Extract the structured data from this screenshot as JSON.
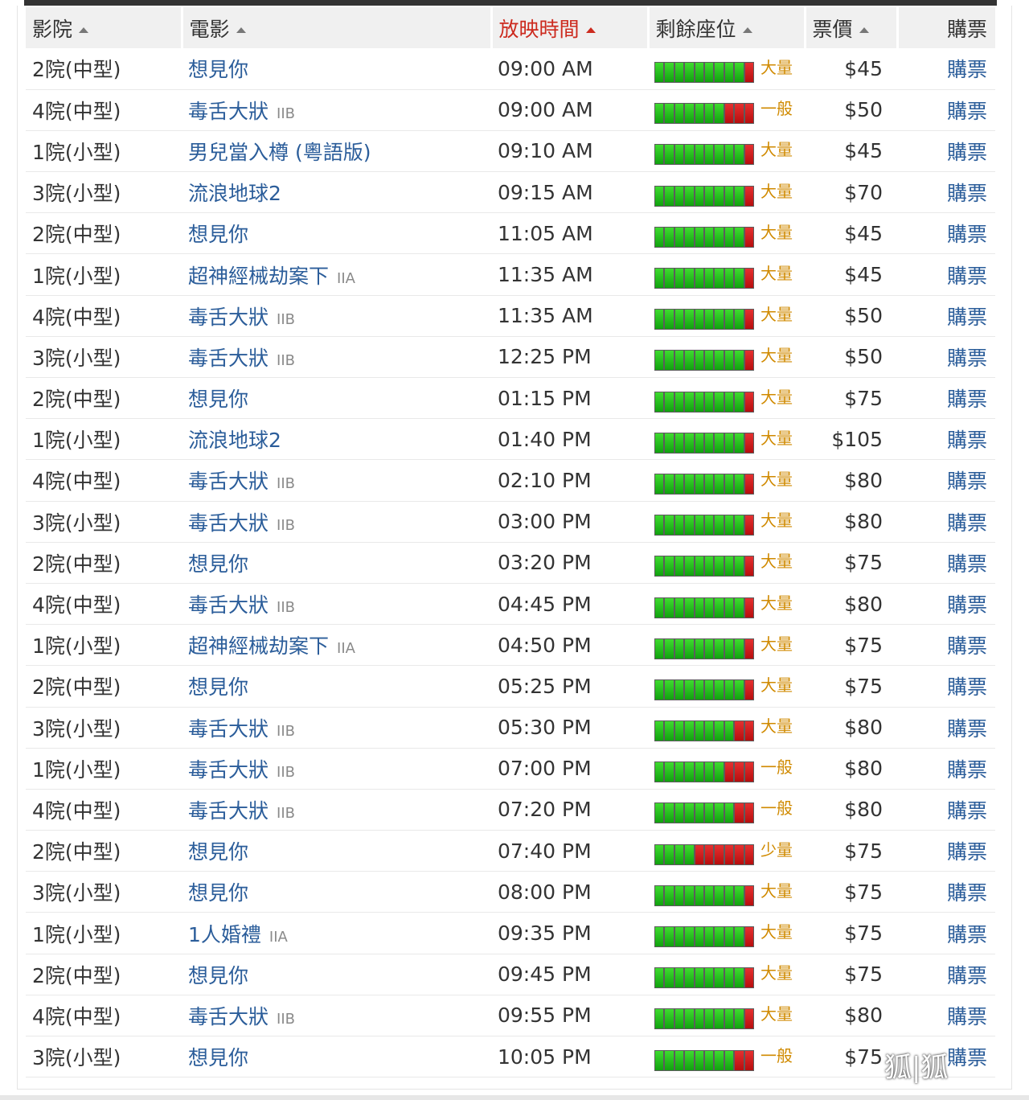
{
  "headers": {
    "cinema": "影院",
    "film": "電影",
    "time": "放映時間",
    "seats": "剩餘座位",
    "price": "票價",
    "buy": "購票"
  },
  "sorted_column": "time",
  "colors": {
    "accent_sort": "#cc2a1e",
    "link": "#2b5d9a",
    "meter_green": "#22c21b",
    "meter_red": "#cc1515",
    "availability_text": "#d08a00"
  },
  "watermark": "狐|狐",
  "rows": [
    {
      "cinema": "2院(中型)",
      "film": "想見你",
      "rating": "",
      "time": "09:00 AM",
      "seats_filled": 9,
      "seats_label": "大量",
      "price": "$45",
      "buy": "購票"
    },
    {
      "cinema": "4院(中型)",
      "film": "毒舌大狀",
      "rating": "IIB",
      "time": "09:00 AM",
      "seats_filled": 7,
      "seats_label": "一般",
      "price": "$50",
      "buy": "購票"
    },
    {
      "cinema": "1院(小型)",
      "film": "男兒當入樽 (粵語版)",
      "rating": "",
      "time": "09:10 AM",
      "seats_filled": 9,
      "seats_label": "大量",
      "price": "$45",
      "buy": "購票"
    },
    {
      "cinema": "3院(小型)",
      "film": "流浪地球2",
      "rating": "",
      "time": "09:15 AM",
      "seats_filled": 9,
      "seats_label": "大量",
      "price": "$70",
      "buy": "購票"
    },
    {
      "cinema": "2院(中型)",
      "film": "想見你",
      "rating": "",
      "time": "11:05 AM",
      "seats_filled": 9,
      "seats_label": "大量",
      "price": "$45",
      "buy": "購票"
    },
    {
      "cinema": "1院(小型)",
      "film": "超神經械劫案下",
      "rating": "IIA",
      "time": "11:35 AM",
      "seats_filled": 9,
      "seats_label": "大量",
      "price": "$45",
      "buy": "購票"
    },
    {
      "cinema": "4院(中型)",
      "film": "毒舌大狀",
      "rating": "IIB",
      "time": "11:35 AM",
      "seats_filled": 9,
      "seats_label": "大量",
      "price": "$50",
      "buy": "購票"
    },
    {
      "cinema": "3院(小型)",
      "film": "毒舌大狀",
      "rating": "IIB",
      "time": "12:25 PM",
      "seats_filled": 9,
      "seats_label": "大量",
      "price": "$50",
      "buy": "購票"
    },
    {
      "cinema": "2院(中型)",
      "film": "想見你",
      "rating": "",
      "time": "01:15 PM",
      "seats_filled": 9,
      "seats_label": "大量",
      "price": "$75",
      "buy": "購票"
    },
    {
      "cinema": "1院(小型)",
      "film": "流浪地球2",
      "rating": "",
      "time": "01:40 PM",
      "seats_filled": 9,
      "seats_label": "大量",
      "price": "$105",
      "buy": "購票"
    },
    {
      "cinema": "4院(中型)",
      "film": "毒舌大狀",
      "rating": "IIB",
      "time": "02:10 PM",
      "seats_filled": 9,
      "seats_label": "大量",
      "price": "$80",
      "buy": "購票"
    },
    {
      "cinema": "3院(小型)",
      "film": "毒舌大狀",
      "rating": "IIB",
      "time": "03:00 PM",
      "seats_filled": 9,
      "seats_label": "大量",
      "price": "$80",
      "buy": "購票"
    },
    {
      "cinema": "2院(中型)",
      "film": "想見你",
      "rating": "",
      "time": "03:20 PM",
      "seats_filled": 9,
      "seats_label": "大量",
      "price": "$75",
      "buy": "購票"
    },
    {
      "cinema": "4院(中型)",
      "film": "毒舌大狀",
      "rating": "IIB",
      "time": "04:45 PM",
      "seats_filled": 9,
      "seats_label": "大量",
      "price": "$80",
      "buy": "購票"
    },
    {
      "cinema": "1院(小型)",
      "film": "超神經械劫案下",
      "rating": "IIA",
      "time": "04:50 PM",
      "seats_filled": 9,
      "seats_label": "大量",
      "price": "$75",
      "buy": "購票"
    },
    {
      "cinema": "2院(中型)",
      "film": "想見你",
      "rating": "",
      "time": "05:25 PM",
      "seats_filled": 9,
      "seats_label": "大量",
      "price": "$75",
      "buy": "購票"
    },
    {
      "cinema": "3院(小型)",
      "film": "毒舌大狀",
      "rating": "IIB",
      "time": "05:30 PM",
      "seats_filled": 8,
      "seats_label": "大量",
      "price": "$80",
      "buy": "購票"
    },
    {
      "cinema": "1院(小型)",
      "film": "毒舌大狀",
      "rating": "IIB",
      "time": "07:00 PM",
      "seats_filled": 7,
      "seats_label": "一般",
      "price": "$80",
      "buy": "購票"
    },
    {
      "cinema": "4院(中型)",
      "film": "毒舌大狀",
      "rating": "IIB",
      "time": "07:20 PM",
      "seats_filled": 8,
      "seats_label": "一般",
      "price": "$80",
      "buy": "購票"
    },
    {
      "cinema": "2院(中型)",
      "film": "想見你",
      "rating": "",
      "time": "07:40 PM",
      "seats_filled": 4,
      "seats_label": "少量",
      "price": "$75",
      "buy": "購票"
    },
    {
      "cinema": "3院(小型)",
      "film": "想見你",
      "rating": "",
      "time": "08:00 PM",
      "seats_filled": 9,
      "seats_label": "大量",
      "price": "$75",
      "buy": "購票"
    },
    {
      "cinema": "1院(小型)",
      "film": "1人婚禮",
      "rating": "IIA",
      "time": "09:35 PM",
      "seats_filled": 9,
      "seats_label": "大量",
      "price": "$75",
      "buy": "購票"
    },
    {
      "cinema": "2院(中型)",
      "film": "想見你",
      "rating": "",
      "time": "09:45 PM",
      "seats_filled": 9,
      "seats_label": "大量",
      "price": "$75",
      "buy": "購票"
    },
    {
      "cinema": "4院(中型)",
      "film": "毒舌大狀",
      "rating": "IIB",
      "time": "09:55 PM",
      "seats_filled": 9,
      "seats_label": "大量",
      "price": "$80",
      "buy": "購票"
    },
    {
      "cinema": "3院(小型)",
      "film": "想見你",
      "rating": "",
      "time": "10:05 PM",
      "seats_filled": 8,
      "seats_label": "一般",
      "price": "$75",
      "buy": "購票"
    }
  ],
  "meter_segments": 10
}
